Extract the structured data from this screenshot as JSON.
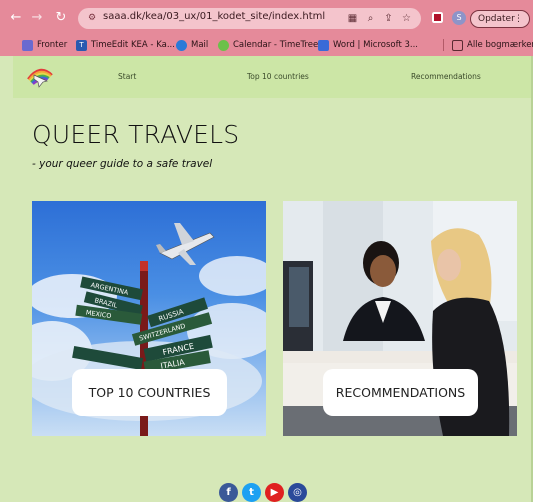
{
  "browser": {
    "url": "saaa.dk/kea/03_ux/01_kodet_site/index.html",
    "update_label": "Opdater",
    "update_dots": "⋮",
    "profile_initial": "S",
    "bookmarks": [
      {
        "label": "Fronter",
        "icon": "fronter-icon",
        "color": "#6a6ad0"
      },
      {
        "label": "TimeEdit KEA - Ka...",
        "icon": "timeedit-icon",
        "color": "#2a5ab0"
      },
      {
        "label": "Mail",
        "icon": "mail-icon",
        "color": "#2a7ad8"
      },
      {
        "label": "Calendar - TimeTree",
        "icon": "calendar-icon",
        "color": "#6cc04a"
      },
      {
        "label": "Word | Microsoft 3...",
        "icon": "word-icon",
        "color": "#3a6ad8"
      },
      {
        "label": "Alle bogmærker",
        "icon": "folder-icon",
        "color": "#7a4a50"
      }
    ]
  },
  "site": {
    "nav": {
      "items": [
        {
          "label": "Start"
        },
        {
          "label": "Top 10 countries"
        },
        {
          "label": "Recommendations"
        }
      ]
    },
    "hero": {
      "title": "QUEER TRAVELS",
      "subtitle": "- your queer guide to a safe travel"
    },
    "cards": [
      {
        "label": "TOP 10 COUNTRIES"
      },
      {
        "label": "RECOMMENDATIONS"
      }
    ],
    "signpost": {
      "signs": [
        "ARGENTINA",
        "BRAZIL",
        "MEXICO",
        "RUSSIA",
        "SWITZERLAND",
        "FRANCE",
        "ITALIA"
      ]
    },
    "social": [
      {
        "icon": "facebook-icon",
        "glyph": "f"
      },
      {
        "icon": "twitter-icon",
        "glyph": "t"
      },
      {
        "icon": "youtube-icon",
        "glyph": "▶"
      },
      {
        "icon": "instagram-icon",
        "glyph": "◎"
      }
    ]
  },
  "colors": {
    "chrome": "#e58a9a",
    "page_bg": "#d6e8b8",
    "nav_bg": "#cce6a6",
    "card_label_bg": "#ffffff"
  }
}
